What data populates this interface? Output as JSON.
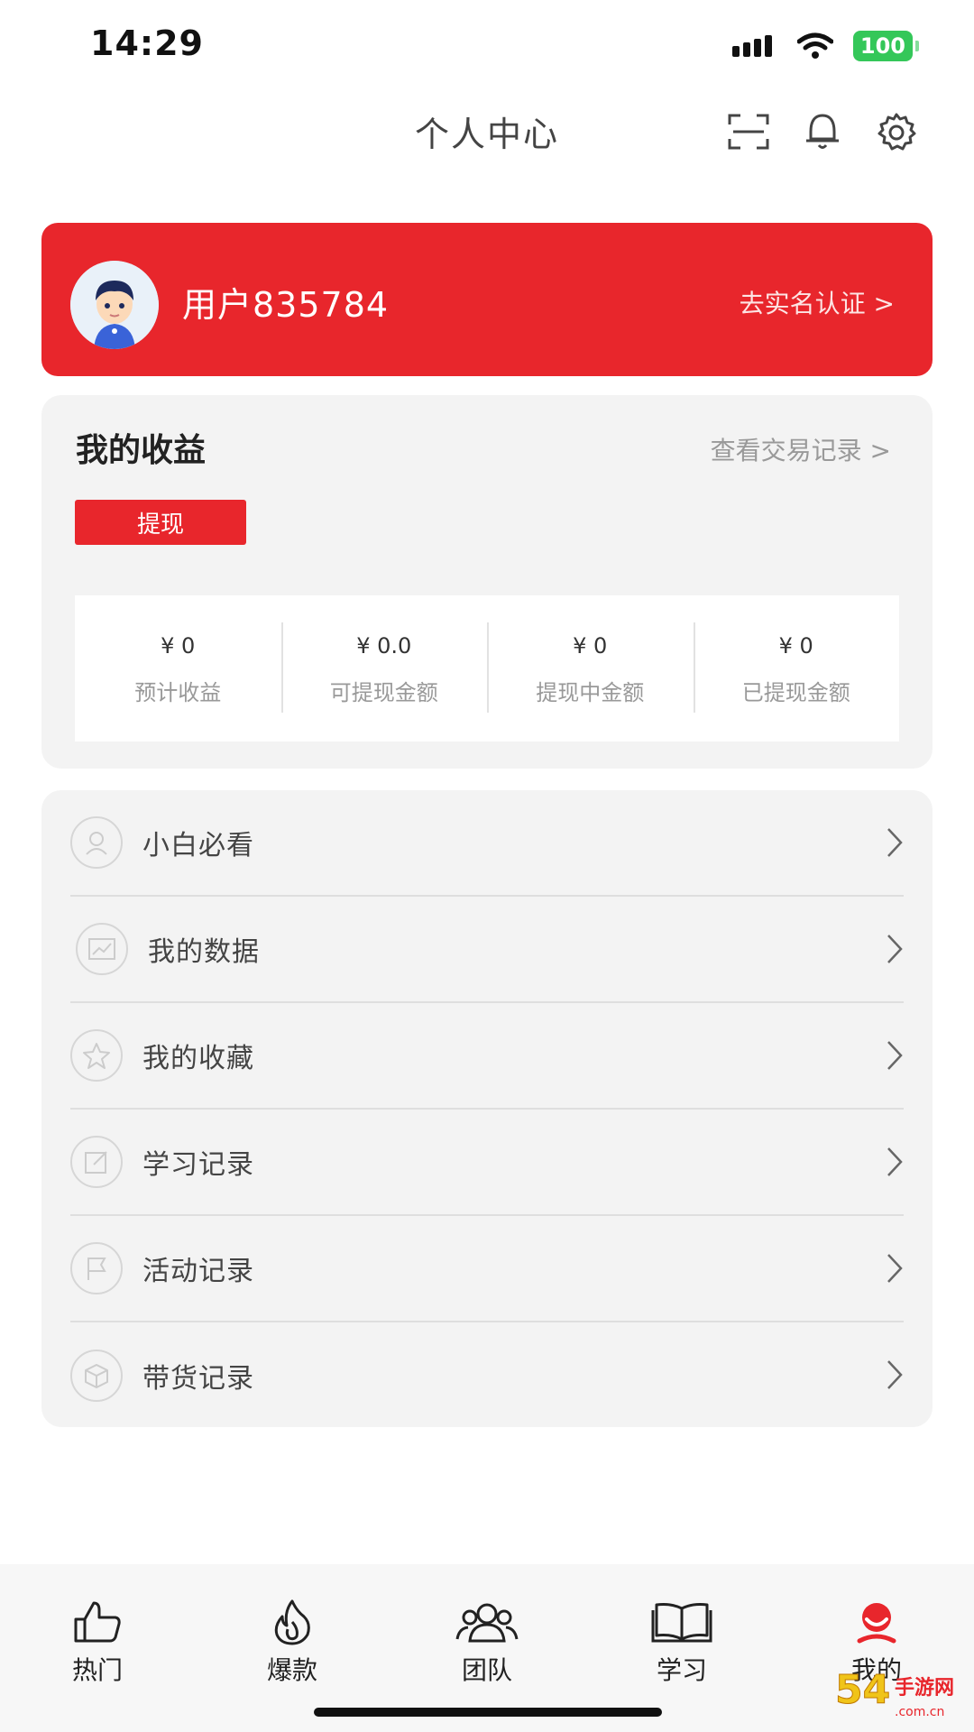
{
  "status": {
    "time": "14:29",
    "battery": "100"
  },
  "header": {
    "title": "个人中心"
  },
  "user": {
    "name": "用户835784",
    "verify_link": "去实名认证 >"
  },
  "earnings": {
    "title": "我的收益",
    "records_link": "查看交易记录 >",
    "withdraw_button": "提现",
    "stats": [
      {
        "value": "¥ 0",
        "label": "预计收益"
      },
      {
        "value": "¥ 0.0",
        "label": "可提现金额"
      },
      {
        "value": "¥ 0",
        "label": "提现中金额"
      },
      {
        "value": "¥ 0",
        "label": "已提现金额"
      }
    ]
  },
  "menu": [
    {
      "label": "小白必看",
      "icon": "person-icon"
    },
    {
      "label": "我的数据",
      "icon": "chart-icon"
    },
    {
      "label": "我的收藏",
      "icon": "star-icon"
    },
    {
      "label": "学习记录",
      "icon": "edit-icon"
    },
    {
      "label": "活动记录",
      "icon": "flag-icon"
    },
    {
      "label": "带货记录",
      "icon": "box-icon"
    }
  ],
  "tabs": [
    {
      "label": "热门",
      "icon": "thumbs-up-icon"
    },
    {
      "label": "爆款",
      "icon": "flame-icon"
    },
    {
      "label": "团队",
      "icon": "team-icon"
    },
    {
      "label": "学习",
      "icon": "book-icon"
    },
    {
      "label": "我的",
      "icon": "profile-icon",
      "active": true
    }
  ],
  "colors": {
    "accent": "#e8262c",
    "card_bg": "#f3f3f3",
    "battery": "#34c759"
  },
  "watermark": {
    "text": "54手游网 .com.cn"
  }
}
